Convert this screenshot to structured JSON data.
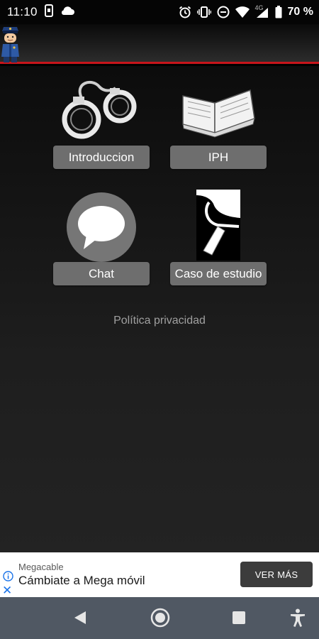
{
  "status_bar": {
    "time": "11:10",
    "network": "4G",
    "battery": "70 %"
  },
  "menu": {
    "introduccion": "Introduccion",
    "iph": "IPH",
    "chat": "Chat",
    "caso": "Caso de estudio",
    "privacy": "Política privacidad"
  },
  "ad": {
    "advertiser": "Megacable",
    "headline": "Cámbiate a Mega móvil",
    "cta": "VER MÁS"
  },
  "colors": {
    "accent_red": "#c8151b",
    "button_gray": "#6e6e6e",
    "nav_bar": "#505863"
  }
}
